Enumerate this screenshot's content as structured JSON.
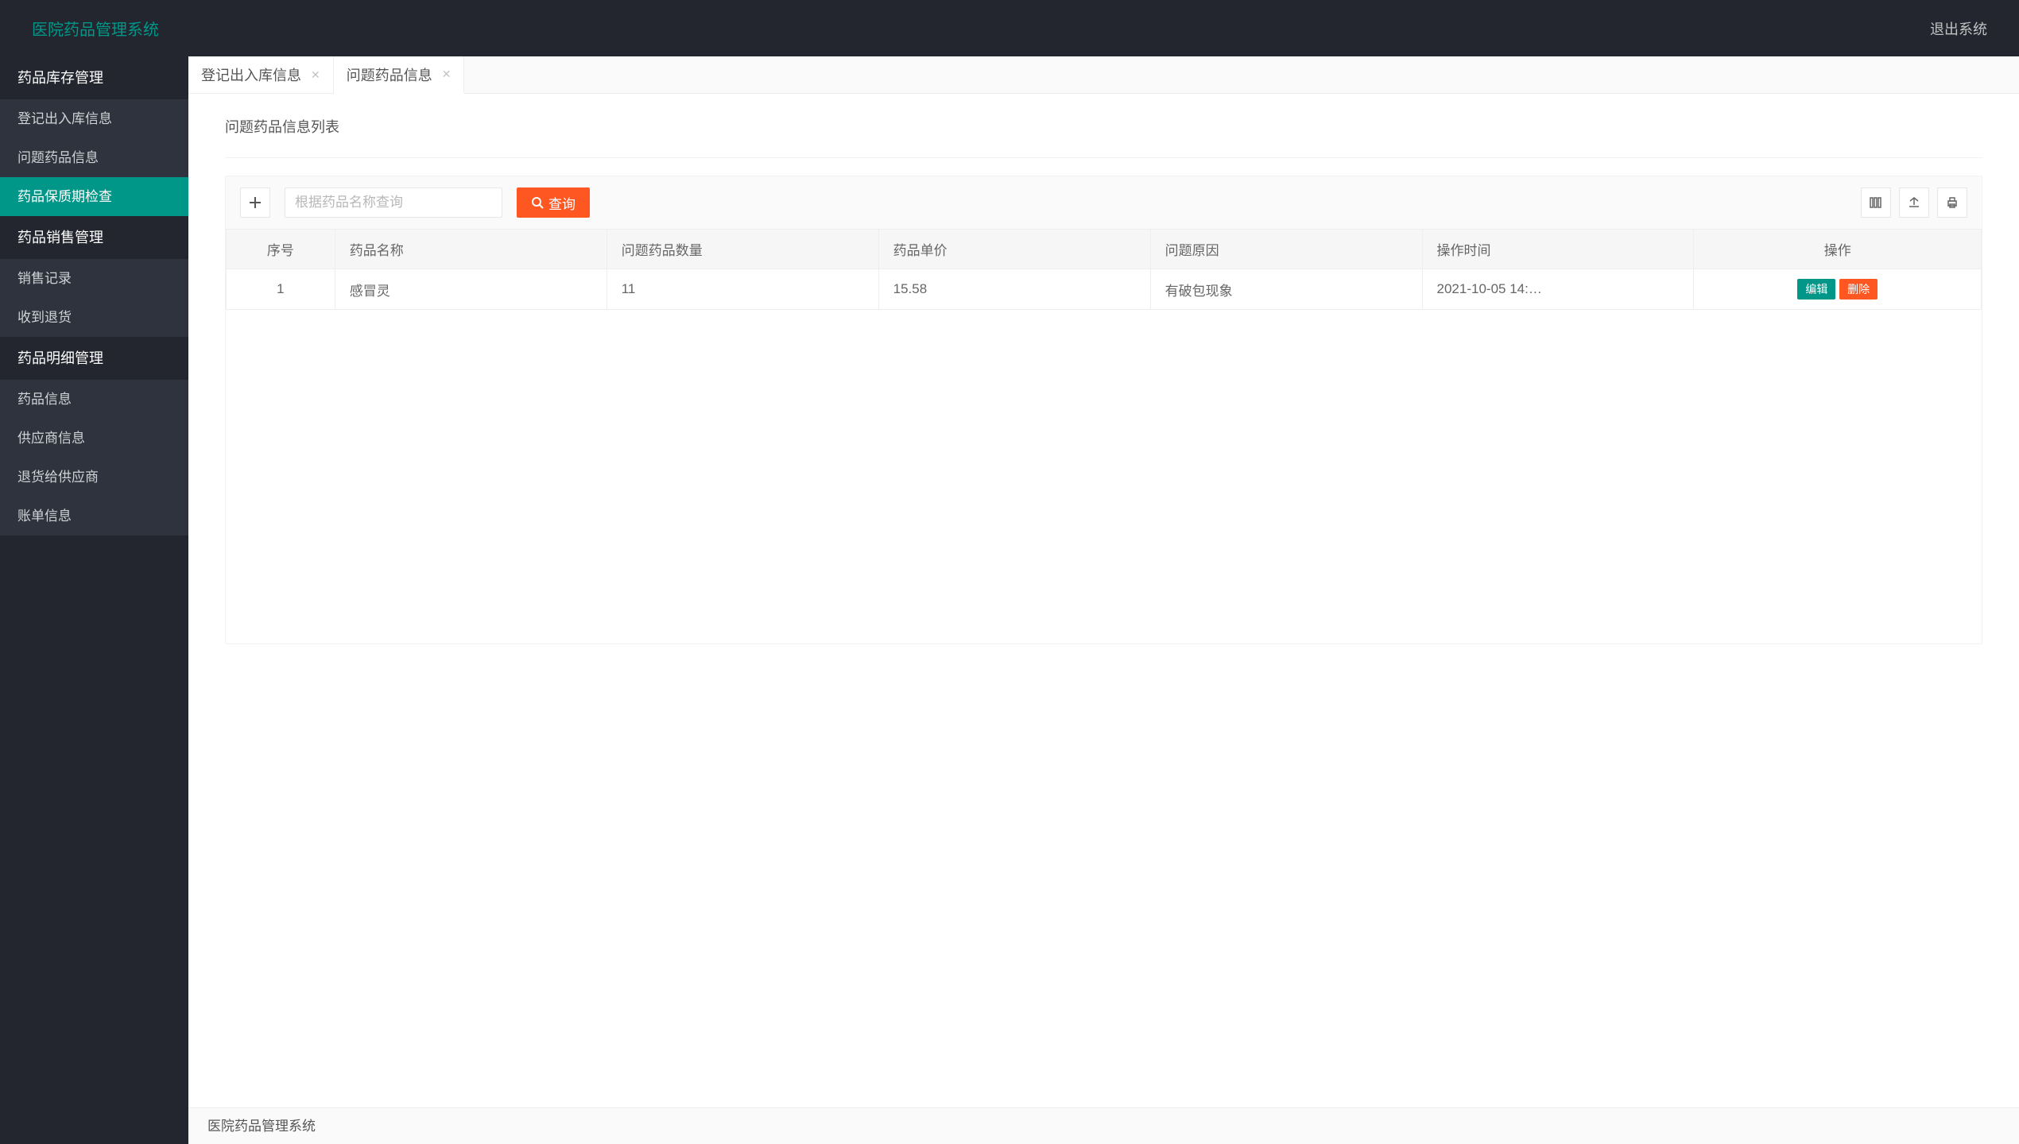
{
  "header": {
    "brand": "医院药品管理系统",
    "logout": "退出系统"
  },
  "sidebar": {
    "groups": [
      {
        "title": "药品库存管理",
        "items": [
          {
            "label": "登记出入库信息"
          },
          {
            "label": "问题药品信息"
          },
          {
            "label": "药品保质期检查"
          }
        ]
      },
      {
        "title": "药品销售管理",
        "items": [
          {
            "label": "销售记录"
          },
          {
            "label": "收到退货"
          }
        ]
      },
      {
        "title": "药品明细管理",
        "items": [
          {
            "label": "药品信息"
          },
          {
            "label": "供应商信息"
          },
          {
            "label": "退货给供应商"
          },
          {
            "label": "账单信息"
          }
        ]
      }
    ]
  },
  "tabs": [
    {
      "label": "登记出入库信息"
    },
    {
      "label": "问题药品信息"
    }
  ],
  "panel": {
    "title": "问题药品信息列表"
  },
  "search": {
    "placeholder": "根据药品名称查询",
    "button": "查询"
  },
  "table": {
    "cols": [
      "序号",
      "药品名称",
      "问题药品数量",
      "药品单价",
      "问题原因",
      "操作时间",
      "操作"
    ],
    "rows": [
      {
        "idx": "1",
        "name": "感冒灵",
        "qty": "11",
        "price": "15.58",
        "reason": "有破包现象",
        "time": "2021-10-05 14:…"
      }
    ],
    "actions": {
      "edit": "编辑",
      "delete": "删除"
    }
  },
  "footer": {
    "text": "医院药品管理系统"
  }
}
